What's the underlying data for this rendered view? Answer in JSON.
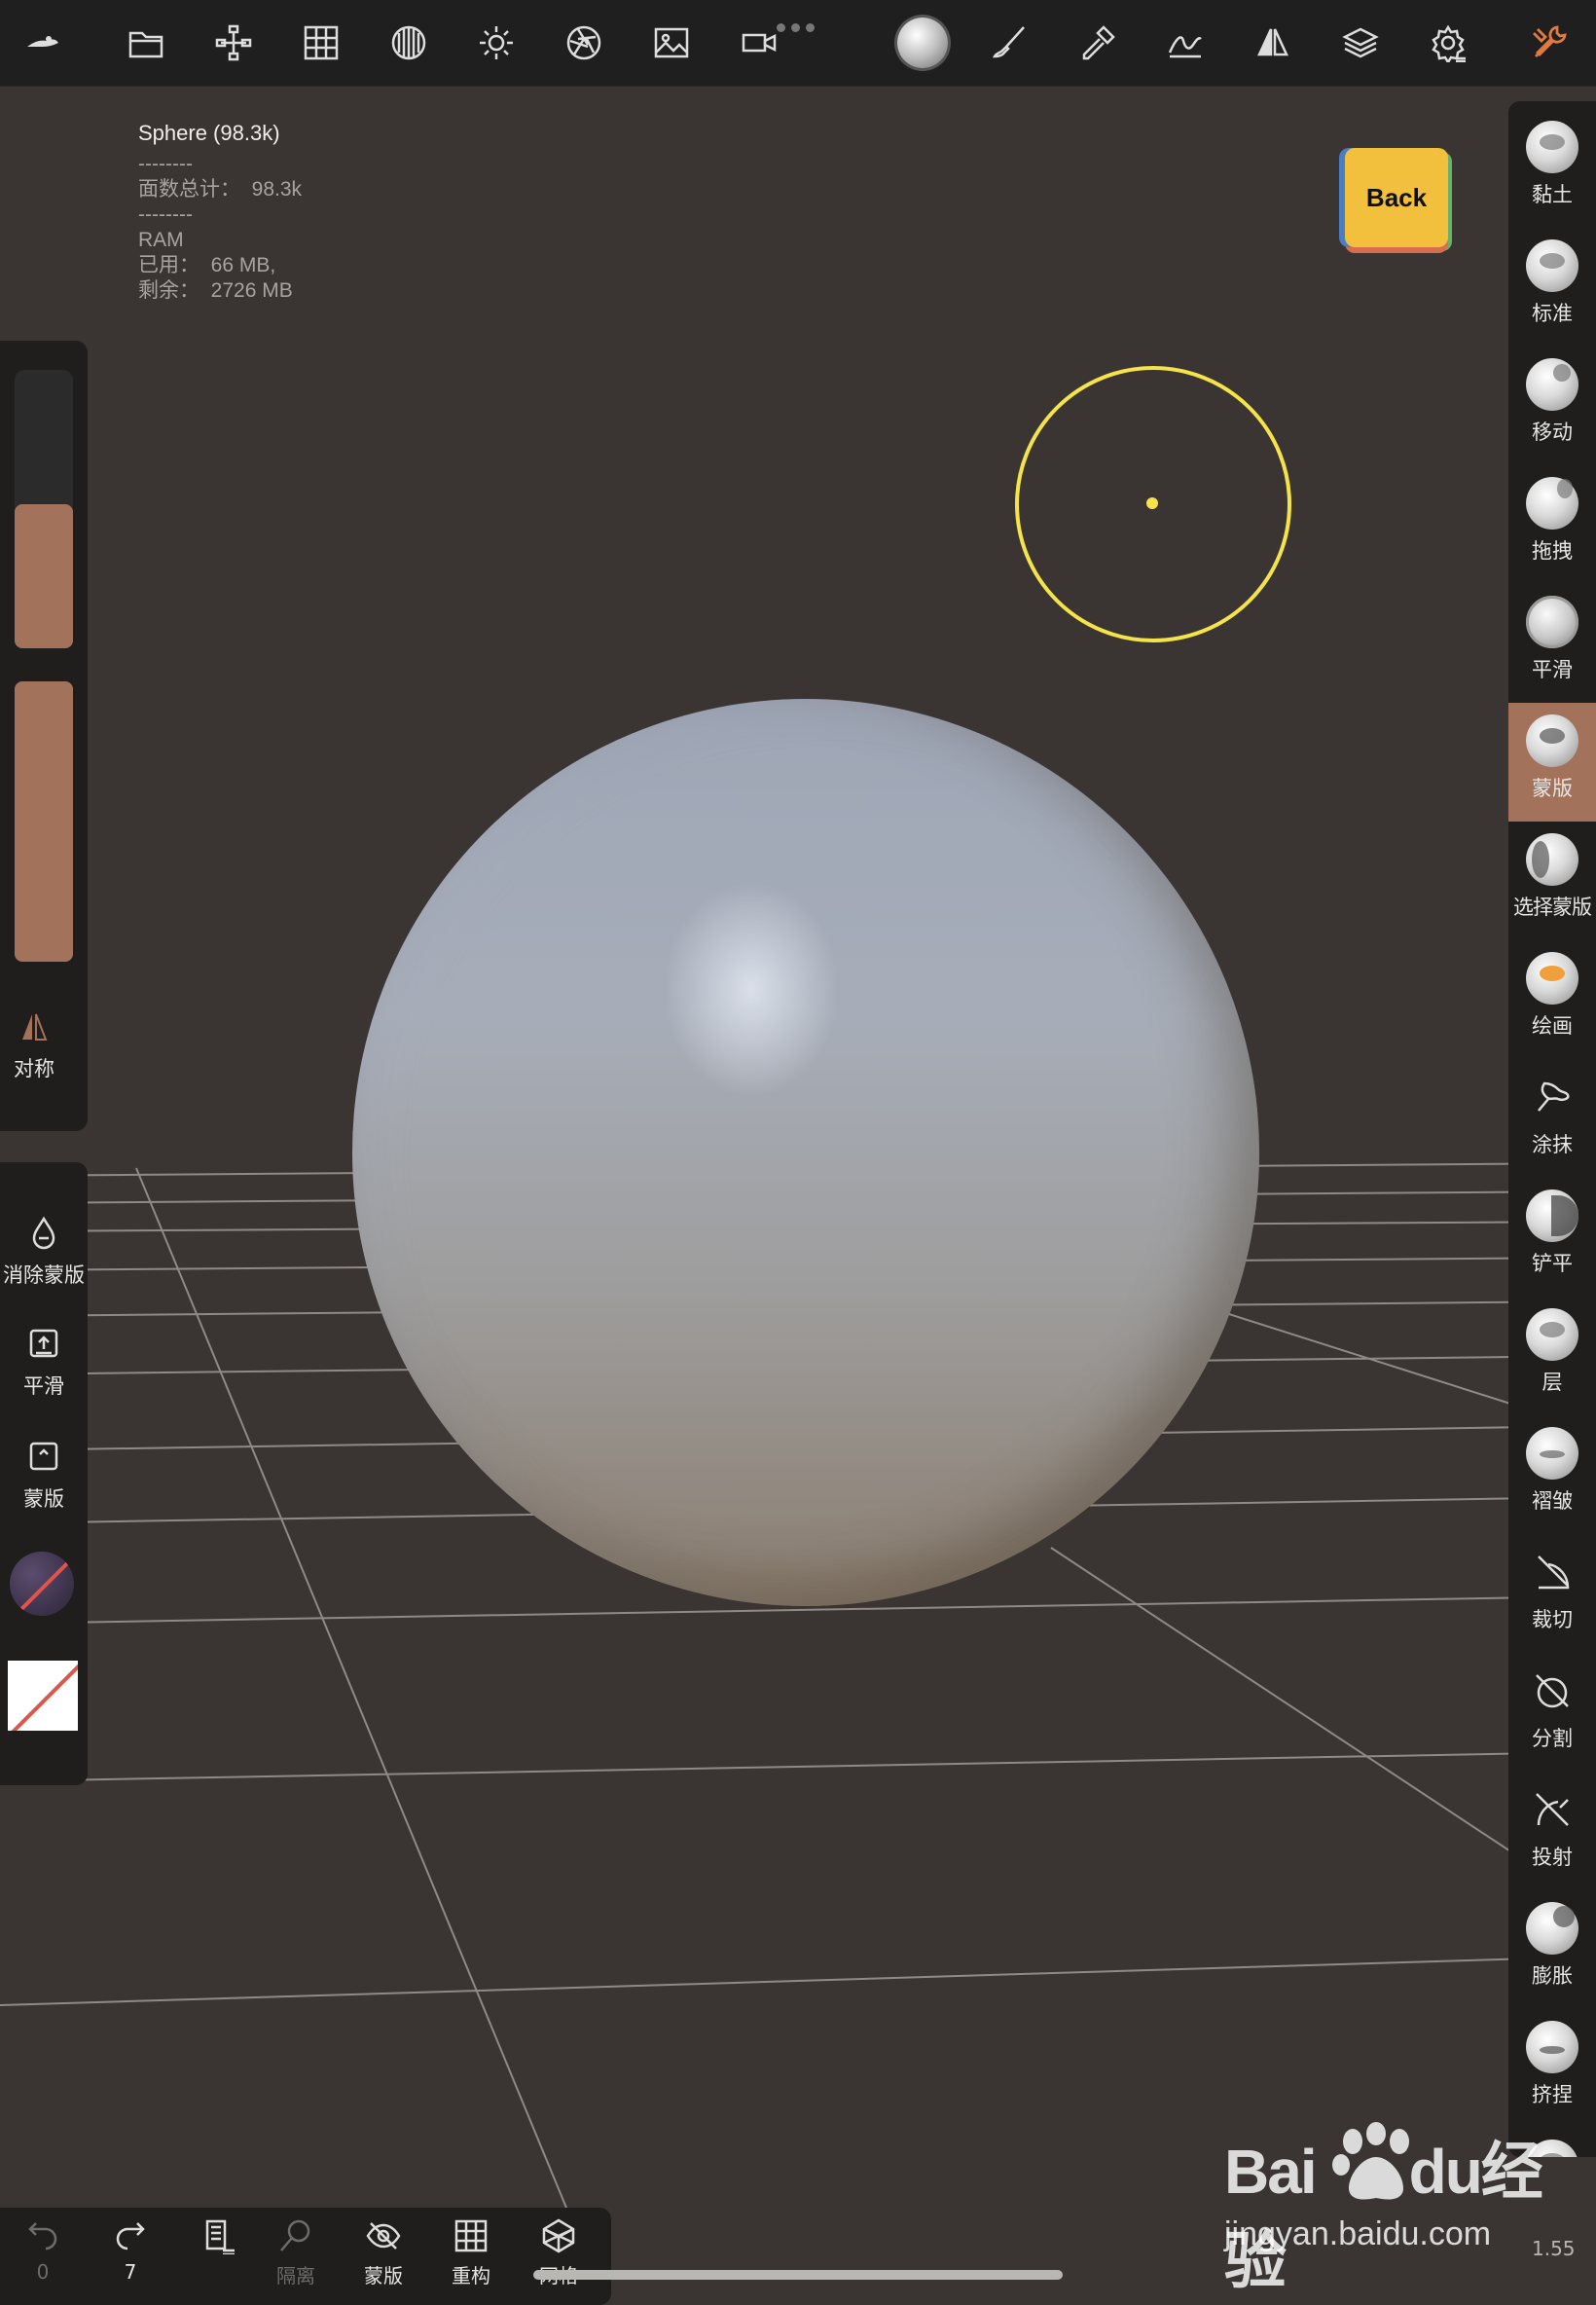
{
  "topbar": {
    "icons": [
      "nomad-logo-icon",
      "folder-icon",
      "scene-tree-icon",
      "grid-icon",
      "texture-sphere-icon",
      "sun-icon",
      "camera-shutter-icon",
      "image-icon",
      "video-camera-icon",
      "material-ball-icon",
      "brush-icon",
      "picker-icon",
      "stroke-icon",
      "symmetry-icon",
      "layers-icon",
      "settings-icon",
      "tools-icon"
    ]
  },
  "info": {
    "title": "Sphere (98.3k)",
    "sep1": "--------",
    "faces": "面数总计：  98.3k",
    "sep2": "--------",
    "ram_label": "RAM",
    "used": "已用：  66 MB,",
    "free": "剩余：  2726 MB"
  },
  "back_cube": {
    "label": "Back"
  },
  "left_panel": {
    "symmetry_label": "对称",
    "clear_mask_label": "消除蒙版",
    "smooth_label": "平滑",
    "mask_label": "蒙版"
  },
  "right_tools": [
    {
      "label": "黏土",
      "icon": "clay-icon"
    },
    {
      "label": "标准",
      "icon": "standard-icon"
    },
    {
      "label": "移动",
      "icon": "move-icon"
    },
    {
      "label": "拖拽",
      "icon": "drag-icon"
    },
    {
      "label": "平滑",
      "icon": "smooth-icon"
    },
    {
      "label": "蒙版",
      "icon": "mask-icon",
      "active": true
    },
    {
      "label": "选择蒙版",
      "icon": "select-mask-icon"
    },
    {
      "label": "绘画",
      "icon": "paint-icon"
    },
    {
      "label": "涂抹",
      "icon": "smudge-icon"
    },
    {
      "label": "铲平",
      "icon": "flatten-icon"
    },
    {
      "label": "层",
      "icon": "layer-icon"
    },
    {
      "label": "褶皱",
      "icon": "crease-icon"
    },
    {
      "label": "裁切",
      "icon": "trim-icon"
    },
    {
      "label": "分割",
      "icon": "split-icon"
    },
    {
      "label": "投射",
      "icon": "project-icon"
    },
    {
      "label": "膨胀",
      "icon": "inflate-icon"
    },
    {
      "label": "挤捏",
      "icon": "pinch-icon"
    }
  ],
  "bottombar": {
    "undo_count": "0",
    "redo_count": "7",
    "isolate_label": "隔离",
    "mask_label": "蒙版",
    "remesh_label": "重构",
    "mesh_label": "网格"
  },
  "corner_value": "1.55",
  "watermark": {
    "logo_left": "Bai",
    "logo_mid": "du",
    "logo_right": "经验",
    "url": "jingyan.baidu.com"
  },
  "colors": {
    "accent": "#a3725a",
    "cursor": "#f4e44a",
    "background": "#3a3532",
    "panel": "#1f1e1d"
  }
}
